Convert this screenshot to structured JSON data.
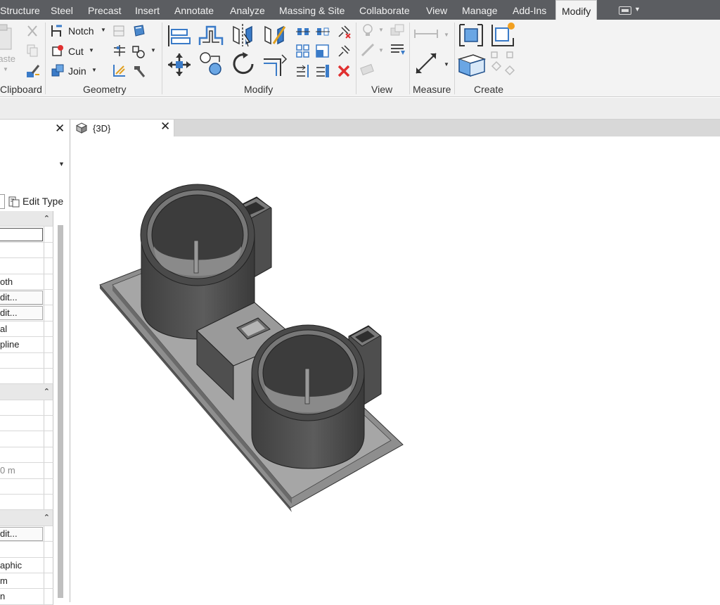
{
  "ribbon_tabs": [
    "Structure",
    "Steel",
    "Precast",
    "Insert",
    "Annotate",
    "Analyze",
    "Massing & Site",
    "Collaborate",
    "View",
    "Manage",
    "Add-Ins",
    "Modify"
  ],
  "active_tab": "Modify",
  "clipboard": {
    "title": "Clipboard",
    "paste_label": "Paste"
  },
  "geometry": {
    "title": "Geometry",
    "notch": "Notch",
    "cut": "Cut",
    "join": "Join"
  },
  "modify": {
    "title": "Modify"
  },
  "view_panel": {
    "title": "View"
  },
  "measure": {
    "title": "Measure"
  },
  "create": {
    "title": "Create"
  },
  "properties": {
    "edit_type": "Edit Type",
    "rows": [
      {
        "kind": "group",
        "text": ""
      },
      {
        "kind": "input",
        "text": ""
      },
      {
        "kind": "plain",
        "text": ""
      },
      {
        "kind": "plain",
        "text": ""
      },
      {
        "kind": "plain",
        "text": "oth"
      },
      {
        "kind": "button",
        "text": "dit..."
      },
      {
        "kind": "button",
        "text": "dit..."
      },
      {
        "kind": "plain",
        "text": "al"
      },
      {
        "kind": "plain",
        "text": "pline"
      },
      {
        "kind": "plain",
        "text": ""
      },
      {
        "kind": "plain",
        "text": ""
      },
      {
        "kind": "group",
        "text": ""
      },
      {
        "kind": "plain",
        "text": ""
      },
      {
        "kind": "plain",
        "text": ""
      },
      {
        "kind": "plain",
        "text": ""
      },
      {
        "kind": "plain",
        "text": ""
      },
      {
        "kind": "grey",
        "text": "0 m"
      },
      {
        "kind": "plain",
        "text": ""
      },
      {
        "kind": "plain",
        "text": ""
      },
      {
        "kind": "group",
        "text": ""
      },
      {
        "kind": "button",
        "text": "dit..."
      },
      {
        "kind": "plain",
        "text": ""
      },
      {
        "kind": "plain",
        "text": "aphic"
      },
      {
        "kind": "plain",
        "text": "m"
      },
      {
        "kind": "plain",
        "text": "n"
      }
    ]
  },
  "view_tab": {
    "label": "{3D}"
  },
  "colors": {
    "tabbar": "#5b5d61",
    "ribbon": "#f3f3f3",
    "accent_blue": "#2f6fb5",
    "model_dark": "#4a4a4a",
    "model_light": "#9a9a9a"
  },
  "icons": [
    "notch-icon",
    "cut-icon",
    "join-icon",
    "align-icon",
    "offset-icon",
    "mirror-axis-icon",
    "mirror-draw-icon",
    "move-icon",
    "copy-icon",
    "rotate-icon",
    "trim-icon",
    "split-icon",
    "array-icon",
    "scale-icon",
    "pin-icon",
    "unpin-icon",
    "delete-icon",
    "measure-icon",
    "create-group-icon",
    "create-similar-icon",
    "view-cube-icon"
  ]
}
